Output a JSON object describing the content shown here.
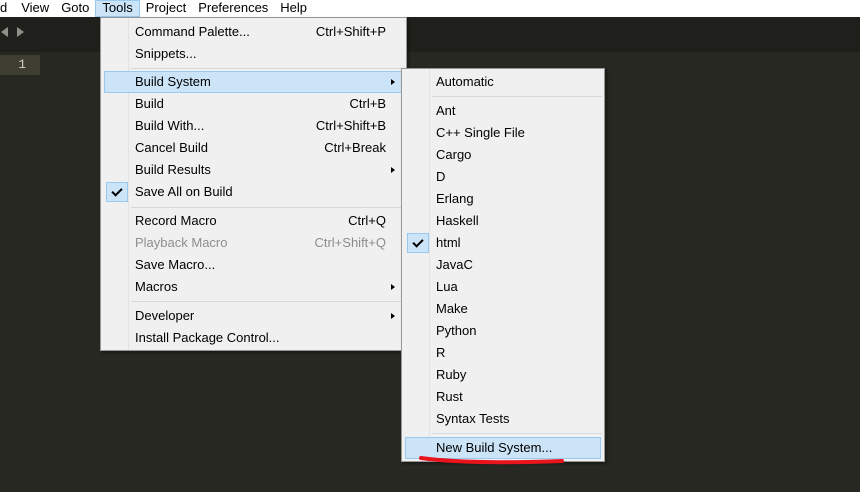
{
  "menubar": {
    "items": [
      {
        "label": "d"
      },
      {
        "label": "View"
      },
      {
        "label": "Goto"
      },
      {
        "label": "Tools"
      },
      {
        "label": "Project"
      },
      {
        "label": "Preferences"
      },
      {
        "label": "Help"
      }
    ]
  },
  "editor": {
    "line_number": "1"
  },
  "tools_menu": {
    "command_palette": {
      "label": "Command Palette...",
      "shortcut": "Ctrl+Shift+P"
    },
    "snippets": {
      "label": "Snippets..."
    },
    "build_system": {
      "label": "Build System"
    },
    "build": {
      "label": "Build",
      "shortcut": "Ctrl+B"
    },
    "build_with": {
      "label": "Build With...",
      "shortcut": "Ctrl+Shift+B"
    },
    "cancel_build": {
      "label": "Cancel Build",
      "shortcut": "Ctrl+Break"
    },
    "build_results": {
      "label": "Build Results"
    },
    "save_all_on_build": {
      "label": "Save All on Build",
      "checked": true
    },
    "record_macro": {
      "label": "Record Macro",
      "shortcut": "Ctrl+Q"
    },
    "playback_macro": {
      "label": "Playback Macro",
      "shortcut": "Ctrl+Shift+Q",
      "disabled": true
    },
    "save_macro": {
      "label": "Save Macro..."
    },
    "macros": {
      "label": "Macros"
    },
    "developer": {
      "label": "Developer"
    },
    "install_package_control": {
      "label": "Install Package Control..."
    }
  },
  "build_system_menu": {
    "automatic": "Automatic",
    "items": [
      "Ant",
      "C++ Single File",
      "Cargo",
      "D",
      "Erlang",
      "Haskell",
      "html",
      "JavaC",
      "Lua",
      "Make",
      "Python",
      "R",
      "Ruby",
      "Rust",
      "Syntax Tests"
    ],
    "selected": "html",
    "new_build_system": "New Build System..."
  },
  "colors": {
    "editor_bg": "#272822",
    "menu_bg": "#f0f0f0",
    "highlight": "#cce4f7",
    "annotation": "#e8141e"
  },
  "icons": [
    "left-arrow-icon",
    "right-arrow-icon",
    "checkmark-icon",
    "submenu-arrow-icon"
  ]
}
